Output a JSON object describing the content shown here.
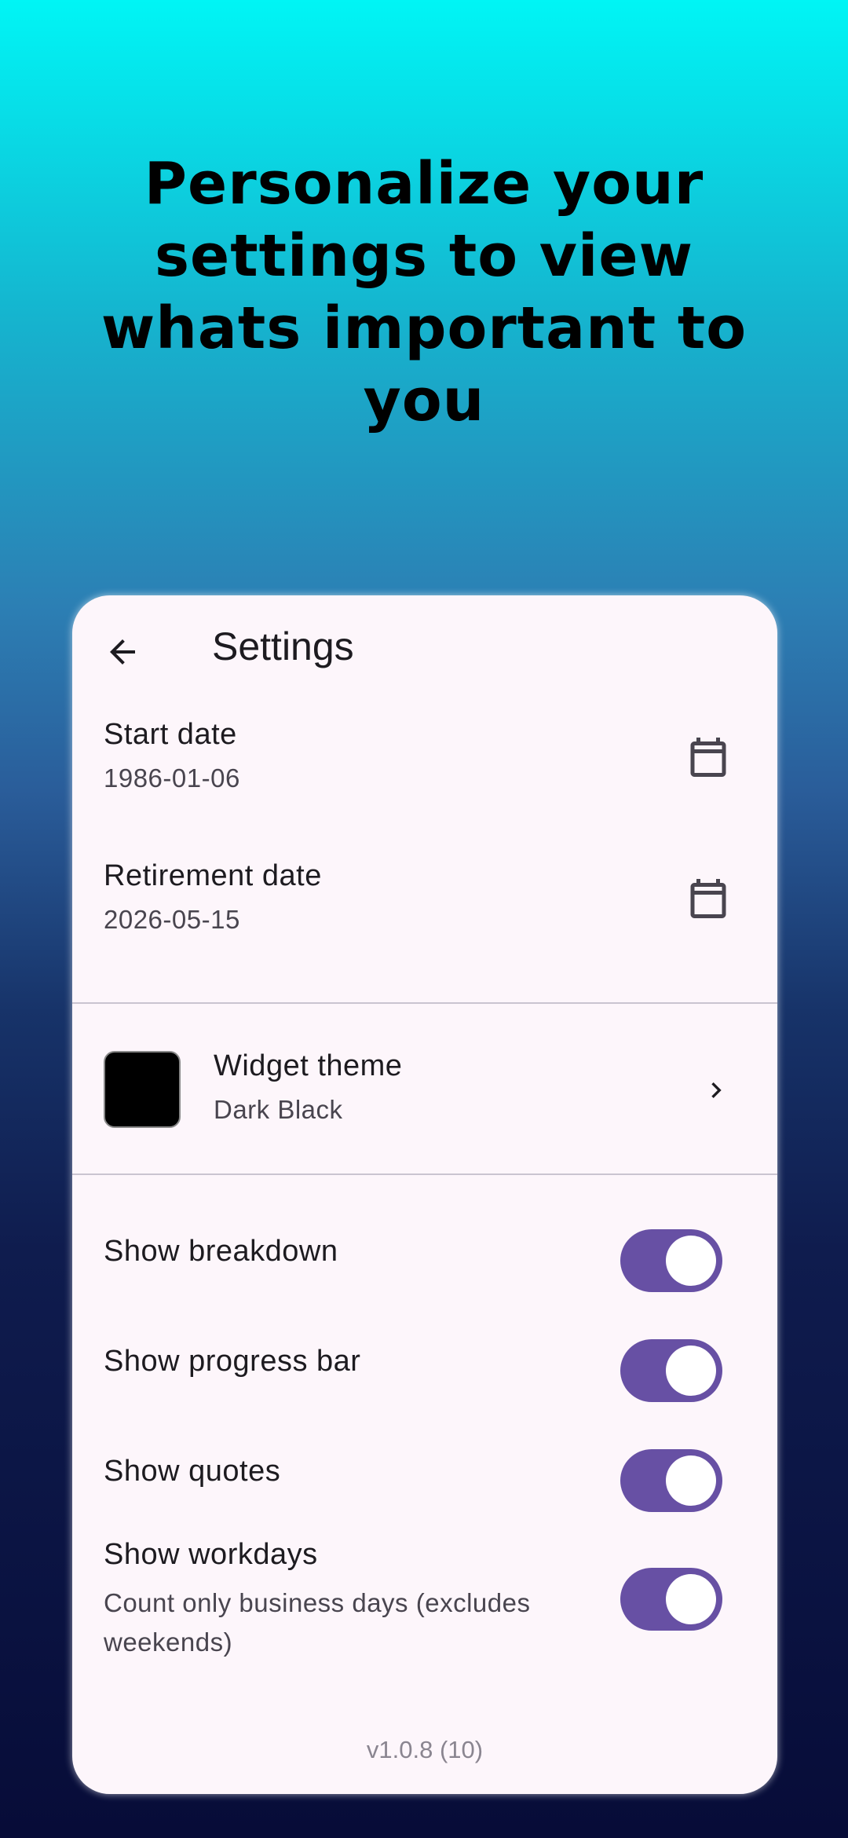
{
  "headline": "Personalize your settings to view whats important to you",
  "appbar": {
    "title": "Settings",
    "back_icon": "arrow-back-icon"
  },
  "dates": {
    "start": {
      "label": "Start date",
      "value": "1986-01-06",
      "icon": "calendar-icon"
    },
    "retirement": {
      "label": "Retirement date",
      "value": "2026-05-15",
      "icon": "calendar-icon"
    }
  },
  "theme": {
    "label": "Widget theme",
    "value": "Dark Black",
    "swatch_color": "#000000",
    "icon": "chevron-right-icon"
  },
  "toggles": [
    {
      "label": "Show breakdown",
      "sub": "",
      "on": true
    },
    {
      "label": "Show progress bar",
      "sub": "",
      "on": true
    },
    {
      "label": "Show quotes",
      "sub": "",
      "on": true
    },
    {
      "label": "Show workdays",
      "sub": "Count only business days (excludes weekends)",
      "on": true
    }
  ],
  "version": "v1.0.8 (10)",
  "colors": {
    "accent": "#6750a4",
    "card_bg": "#fdf6fb",
    "gradient_top": "#00f5f5",
    "gradient_bottom": "#070c38"
  }
}
